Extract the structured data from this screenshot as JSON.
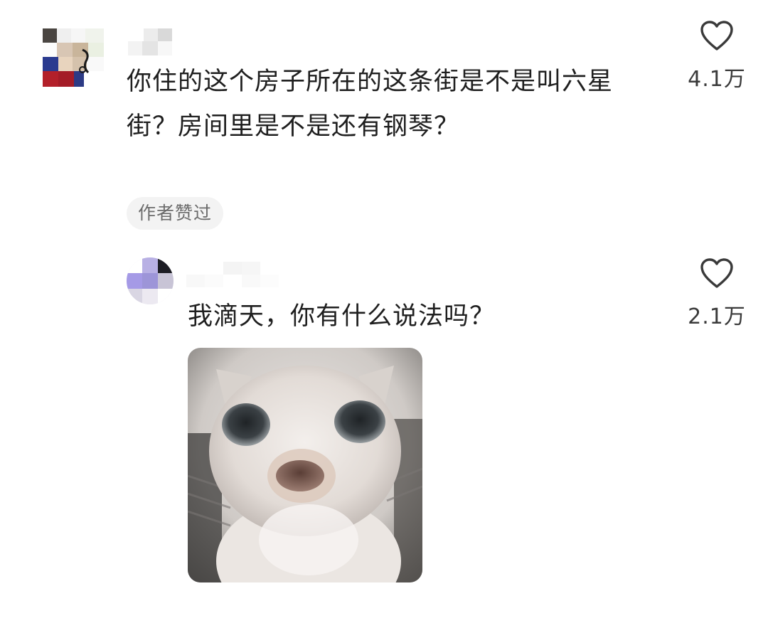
{
  "comment": {
    "text": "你住的这个房子所在的这条街是不是叫六星街？房间里是不是还有钢琴？",
    "like_count": "4.1万",
    "author_liked_badge": "作者赞过",
    "like_icon": "heart-outline-icon"
  },
  "reply": {
    "text": "我滴天，你有什么说法吗？",
    "like_count": "2.1万",
    "like_icon": "heart-outline-icon",
    "image": "kitten-meme-image"
  },
  "colors": {
    "text": "#1f1f1f",
    "secondary_text": "#3a3a3a",
    "badge_background": "#f3f3f3",
    "badge_text": "#6b6b6b"
  }
}
